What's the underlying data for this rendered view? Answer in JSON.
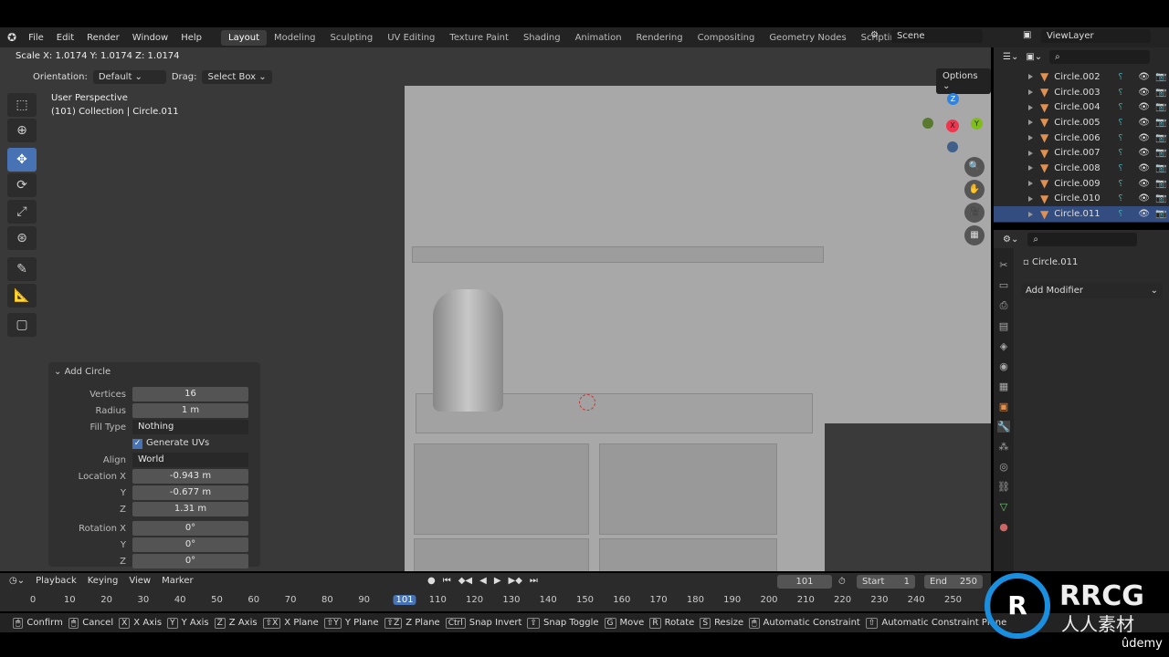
{
  "menu": [
    "File",
    "Edit",
    "Render",
    "Window",
    "Help"
  ],
  "workspaces": [
    "Layout",
    "Modeling",
    "Sculpting",
    "UV Editing",
    "Texture Paint",
    "Shading",
    "Animation",
    "Rendering",
    "Compositing",
    "Geometry Nodes",
    "Scripting"
  ],
  "active_workspace": "Layout",
  "scene": "Scene",
  "view_layer": "ViewLayer",
  "header": {
    "scale_text": "Scale X: 1.0174  Y: 1.0174  Z: 1.0174",
    "orientation_label": "Orientation:",
    "orientation_value": "Default",
    "drag_label": "Drag:",
    "drag_value": "Select Box",
    "options": "Options"
  },
  "viewport": {
    "perspective": "User Perspective",
    "collection": "(101) Collection | Circle.011",
    "key_hint": "S"
  },
  "outliner": {
    "items": [
      "Circle.002",
      "Circle.003",
      "Circle.004",
      "Circle.005",
      "Circle.006",
      "Circle.007",
      "Circle.008",
      "Circle.009",
      "Circle.010",
      "Circle.011"
    ],
    "selected": "Circle.011"
  },
  "properties": {
    "object": "Circle.011",
    "add_modifier": "Add Modifier"
  },
  "add_circle": {
    "title": "Add Circle",
    "fields": [
      {
        "label": "Vertices",
        "value": "16"
      },
      {
        "label": "Radius",
        "value": "1 m"
      },
      {
        "label": "Fill Type",
        "value": "Nothing"
      },
      {
        "label": "",
        "value": "Generate UVs"
      },
      {
        "label": "Align",
        "value": "World"
      },
      {
        "label": "Location X",
        "value": "-0.943 m"
      },
      {
        "label": "Y",
        "value": "-0.677 m"
      },
      {
        "label": "Z",
        "value": "1.31 m"
      },
      {
        "label": "Rotation X",
        "value": "0°"
      },
      {
        "label": "Y",
        "value": "0°"
      },
      {
        "label": "Z",
        "value": "0°"
      }
    ]
  },
  "timeline": {
    "menus": [
      "Playback",
      "Keying",
      "View",
      "Marker"
    ],
    "current_frame": "101",
    "start_label": "Start",
    "start": "1",
    "end_label": "End",
    "end": "250",
    "ticks": [
      "0",
      "10",
      "20",
      "30",
      "40",
      "50",
      "60",
      "70",
      "80",
      "90",
      "101",
      "110",
      "120",
      "130",
      "140",
      "150",
      "160",
      "170",
      "180",
      "190",
      "200",
      "210",
      "220",
      "230",
      "240",
      "250"
    ]
  },
  "status": [
    [
      "",
      "Confirm"
    ],
    [
      "",
      "Cancel"
    ],
    [
      "X",
      "X Axis"
    ],
    [
      "Y",
      "Y Axis"
    ],
    [
      "Z",
      "Z Axis"
    ],
    [
      "⇧X",
      "X Plane"
    ],
    [
      "⇧Y",
      "Y Plane"
    ],
    [
      "⇧Z",
      "Z Plane"
    ],
    [
      "Ctrl",
      "Snap Invert"
    ],
    [
      "⇧",
      "Snap Toggle"
    ],
    [
      "G",
      "Move"
    ],
    [
      "R",
      "Rotate"
    ],
    [
      "S",
      "Resize"
    ],
    [
      "",
      "Automatic Constraint"
    ],
    [
      "⇧",
      "Automatic Constraint Plane"
    ]
  ],
  "watermark": {
    "brand": "RRCG",
    "sub": "人人素材",
    "udemy": "ûdemy"
  },
  "colors": {
    "accent": "#4772b3",
    "x_axis": "#f0364f",
    "y_axis": "#7fbc1c",
    "z_axis": "#2f83e3"
  }
}
